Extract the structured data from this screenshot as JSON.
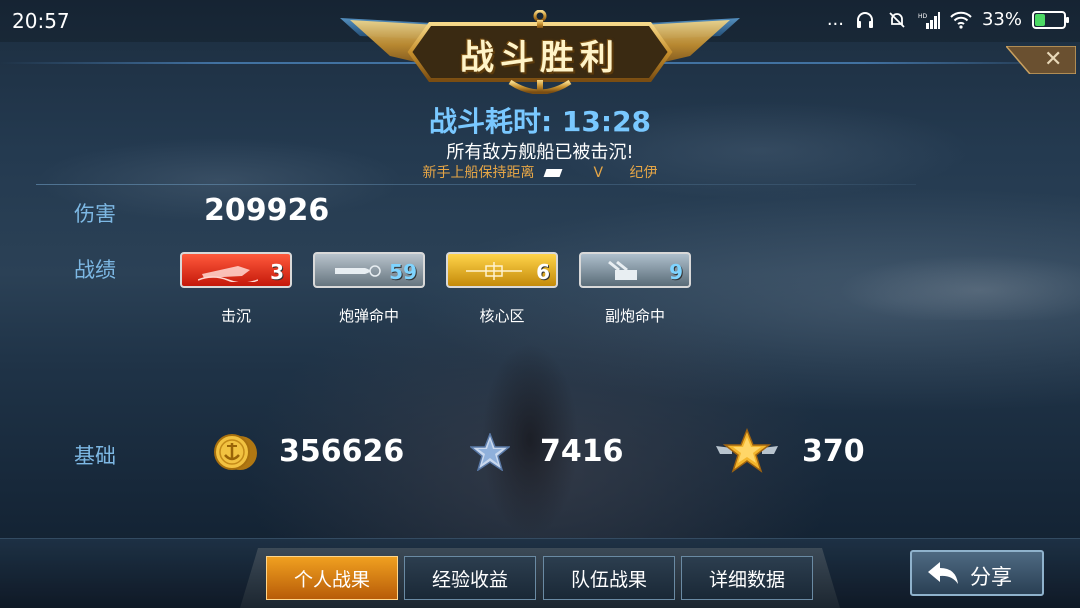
{
  "status_bar": {
    "time": "20:57",
    "dots": "...",
    "battery_percent": "33%"
  },
  "header": {
    "title": "战斗胜利",
    "close_label": "✕"
  },
  "battle": {
    "duration_label": "战斗耗时:",
    "duration_value": "13:28",
    "result_message": "所有敌方舰船已被击沉!",
    "player_left": "新手上船保持距离",
    "versus": "V",
    "player_right": "纪伊"
  },
  "stats": {
    "damage_label": "伤害",
    "damage_value": "209926",
    "record_label": "战绩",
    "medals": [
      {
        "name": "击沉",
        "count": "3",
        "color": "#e0301a"
      },
      {
        "name": "炮弹命中",
        "count": "59",
        "color": "#8c98a3"
      },
      {
        "name": "核心区",
        "count": "6",
        "color": "#e6a818"
      },
      {
        "name": "副炮命中",
        "count": "9",
        "color": "#8192a0"
      }
    ],
    "base_label": "基础",
    "base_rewards": {
      "coins": "356626",
      "silver_star_exp": "7416",
      "gold_star_exp": "370"
    }
  },
  "tabs": [
    {
      "label": "个人战果",
      "active": true
    },
    {
      "label": "经验收益",
      "active": false
    },
    {
      "label": "队伍战果",
      "active": false
    },
    {
      "label": "详细数据",
      "active": false
    }
  ],
  "share": {
    "label": "分享"
  },
  "colors": {
    "accent_blue": "#79c8ff",
    "label_blue": "#7db8e4",
    "active_tab": "#f0a020"
  }
}
